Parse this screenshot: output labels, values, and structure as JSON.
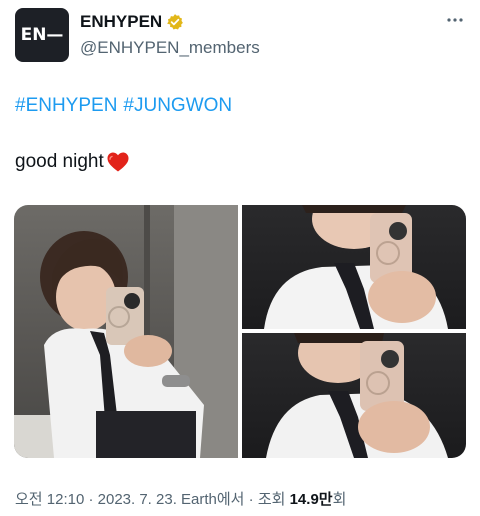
{
  "profile": {
    "avatar_text": "EN—",
    "display_name": "ENHYPEN",
    "handle": "@ENHYPEN_members",
    "verified_color": "#e2b719"
  },
  "tweet": {
    "hashtags": [
      "#ENHYPEN",
      "#JUNGWON"
    ],
    "text": "good night",
    "hashtag_color": "#1d9bf0"
  },
  "media": {
    "photo_count": 3
  },
  "meta": {
    "timestamp": "오전 12:10 · 2023. 7. 23. Earth에서 · 조회 ",
    "views_count": "14.9만",
    "views_suffix": "회"
  },
  "icons": {
    "verified": "verified-badge-icon",
    "more": "more-dots-icon",
    "heart": "red-heart-icon"
  }
}
